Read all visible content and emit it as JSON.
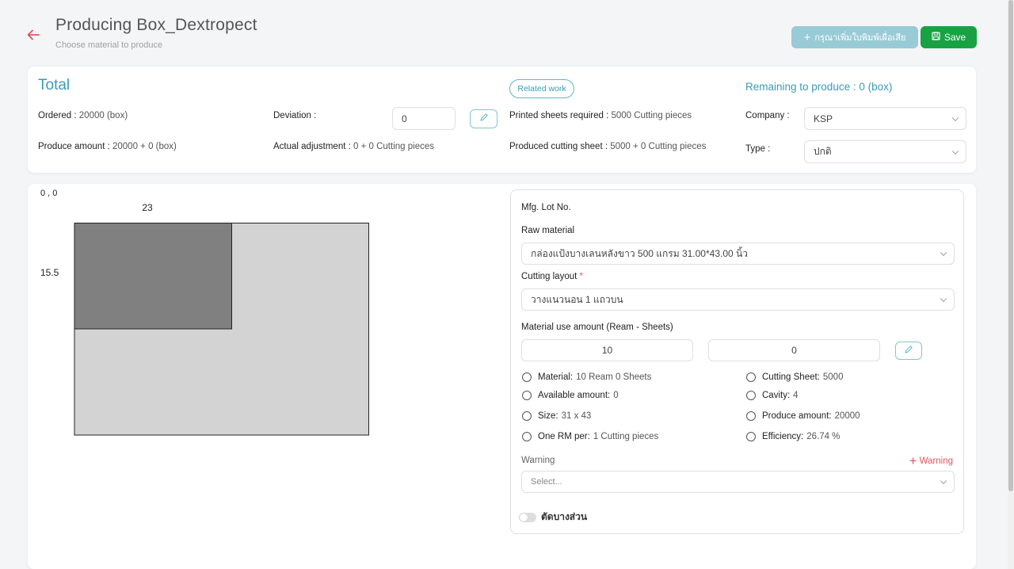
{
  "header": {
    "title": "Producing Box_Dextropect",
    "subtitle": "Choose material to produce",
    "add_label": "กรุณาเพิ่มใบพิมพ์เผื่อเสีย",
    "save_label": "Save"
  },
  "summary": {
    "total_title": "Total",
    "ordered_label": "Ordered :",
    "ordered_value": "20000 (box)",
    "produce_label": "Produce amount :",
    "produce_value": "20000 + 0 (box)",
    "deviation_label": "Deviation :",
    "deviation_value": "0",
    "actual_label": "Actual adjustment :",
    "actual_value": "0 + 0 Cutting pieces",
    "related_label": "Related work",
    "printed_label": "Printed sheets required :",
    "printed_value": "5000 Cutting pieces",
    "produced_label": "Produced cutting sheet :",
    "produced_value": "5000 + 0 Cutting pieces",
    "remaining_label": "Remaining to produce : 0 (box)",
    "company_label": "Company :",
    "company_value": "KSP",
    "type_label": "Type :",
    "type_value": "ปกติ"
  },
  "diagram": {
    "origin_label": "0 , 0",
    "width_label": "23",
    "height_label": "15.5"
  },
  "form": {
    "lot_label": "Mfg. Lot No.",
    "raw_label": "Raw material",
    "raw_value": "กล่องแป้งบางเลนหลังขาว 500 แกรม 31.00*43.00 นิ้ว",
    "layout_label": "Cutting layout",
    "layout_required": "*",
    "layout_value": "วางแนวนอน 1 แถวบน",
    "amount_label": "Material use amount (Ream - Sheets)",
    "ream_value": "10",
    "sheets_value": "0",
    "stats_left": [
      {
        "label": "Material:",
        "value": "10 Ream 0 Sheets"
      },
      {
        "label": "Available amount:",
        "value": "0"
      },
      {
        "label": "Size:",
        "value": "31 x 43"
      },
      {
        "label": "One RM per:",
        "value": "1 Cutting pieces"
      }
    ],
    "stats_right": [
      {
        "label": "Cutting Sheet:",
        "value": "5000"
      },
      {
        "label": "Cavity:",
        "value": "4"
      },
      {
        "label": "Produce amount:",
        "value": "20000"
      },
      {
        "label": "Efficiency:",
        "value": "26.74 %"
      }
    ],
    "warning_label": "Warning",
    "warning_add": "Warning",
    "warning_placeholder": "Select...",
    "partial_cut_label": "ตัดบางส่วน"
  },
  "colors": {
    "accent": "#3a9bb7",
    "save": "#18a244",
    "danger": "#e05565"
  }
}
